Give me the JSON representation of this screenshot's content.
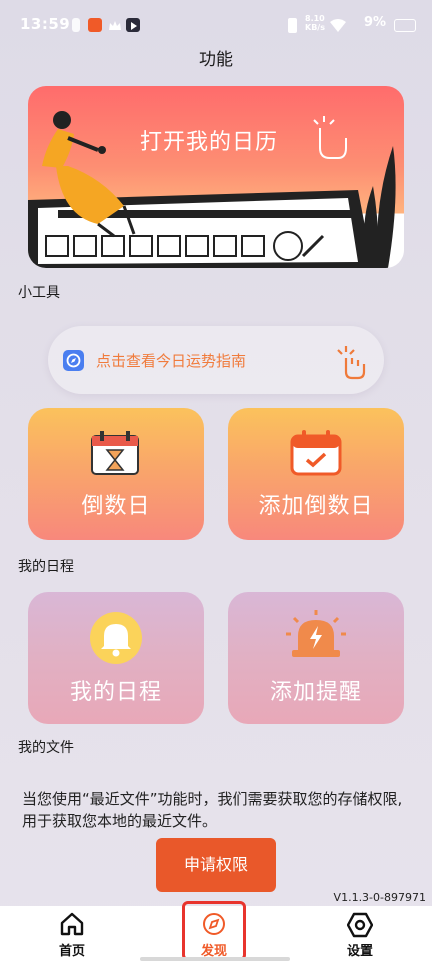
{
  "status_bar": {
    "time": "13:59",
    "network_speed_value": "8.10",
    "network_speed_unit": "KB/s",
    "battery": "9%"
  },
  "page": {
    "title": "功能"
  },
  "banner": {
    "text": "打开我的日历"
  },
  "tools": {
    "section_title": "小工具",
    "fortune_link": "点击查看今日运势指南",
    "countdown_label": "倒数日",
    "add_countdown_label": "添加倒数日"
  },
  "schedule": {
    "section_title": "我的日程",
    "my_schedule_label": "我的日程",
    "add_reminder_label": "添加提醒"
  },
  "files": {
    "section_title": "我的文件",
    "permission_text": "当您使用“最近文件”功能时，我们需要获取您的存储权限,用于获取您本地的最近文件。",
    "request_button": "申请权限"
  },
  "version": "V1.1.3-0-897971",
  "tabbar": {
    "home": "首页",
    "discover": "发现",
    "settings": "设置",
    "active": "discover"
  },
  "colors": {
    "accent": "#e9582a",
    "link_orange": "#f07b3c",
    "tab_highlight": "#e8342d"
  }
}
